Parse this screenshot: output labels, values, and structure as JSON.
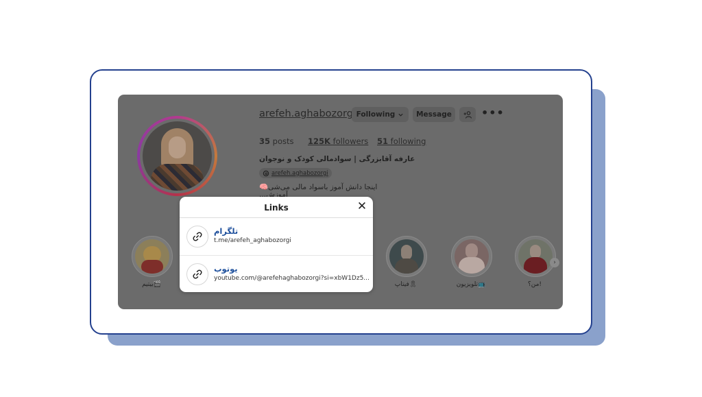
{
  "profile": {
    "username": "arefeh.aghabozorgi",
    "following_label": "Following",
    "message_label": "Message",
    "posts_count": "35",
    "posts_label": "posts",
    "followers_count": "125K",
    "followers_label": "followers",
    "following_count": "51",
    "following_stat_label": "following",
    "full_name": "عارفه آقابزرگی | سوادمالی کودک و نوجوان",
    "threads_handle": "arefeh.aghabozorgi",
    "bio_line1": "اینجا دانش آموز باسواد مالی می‌شی🧠",
    "bio_line2": "آموزش..."
  },
  "highlights": [
    {
      "label": "بیتیم🎬"
    },
    {
      "label": "فیتاپ🎗"
    },
    {
      "label": "تلویزیون📺"
    },
    {
      "label": "من؟!"
    }
  ],
  "modal": {
    "title": "Links",
    "links": [
      {
        "title": "تلگرام",
        "url": "t.me/arefeh_aghabozorgi"
      },
      {
        "title": "یوتوب",
        "url": "youtube.com/@arefehaghabozorgi?si=xbW1Dz5..."
      }
    ]
  },
  "colors": {
    "frame_border": "#23408e",
    "shadow_card": "#8aa1cb",
    "overlay_gray": "#6b6b6b",
    "link_title": "#1d4f9c"
  }
}
